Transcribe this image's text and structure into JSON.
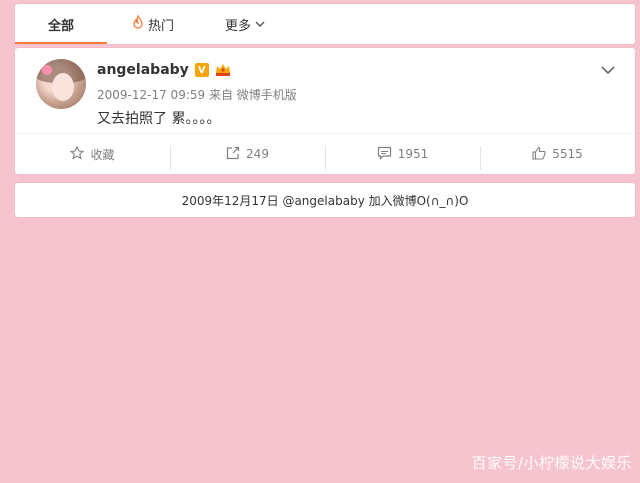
{
  "tabs": [
    {
      "label": "全部",
      "active": true
    },
    {
      "label": "热门",
      "icon": "fire-icon"
    },
    {
      "label": "更多",
      "icon": "chevron-down-icon"
    }
  ],
  "post": {
    "author": "angelababy",
    "meta": "2009-12-17 09:59 来自 微博手机版",
    "text": "又去拍照了 累。。。。"
  },
  "actions": {
    "favorite_label": "收藏",
    "repost_count": "249",
    "comment_count": "1951",
    "like_count": "5515"
  },
  "footer": {
    "text": "2009年12月17日 @angelababy 加入微博O(∩_∩)O"
  },
  "watermark": "百家号/小柠檬说大娱乐",
  "colors": {
    "accent": "#fa7d3c",
    "background": "#f6c4cf",
    "vip": "#f7a50a"
  }
}
